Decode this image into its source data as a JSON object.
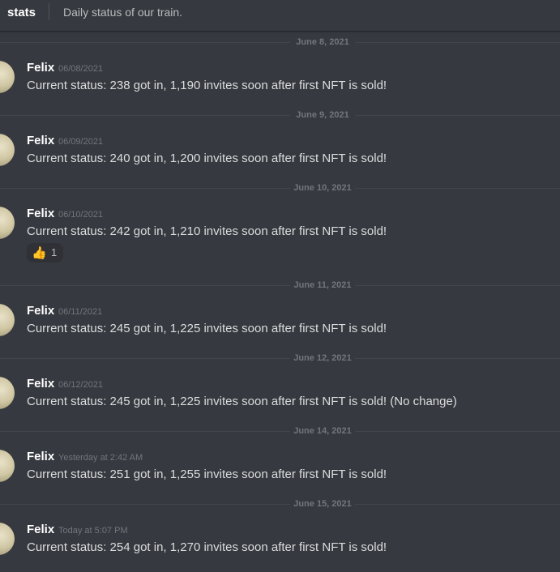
{
  "header": {
    "channel_name": "stats",
    "topic": "Daily status of our train."
  },
  "messages": [
    {
      "date": "June 8, 2021",
      "author": "Felix",
      "timestamp": "06/08/2021",
      "content": "Current status: 238 got in, 1,190 invites soon after first NFT is sold!"
    },
    {
      "date": "June 9, 2021",
      "author": "Felix",
      "timestamp": "06/09/2021",
      "content": "Current status: 240 got in, 1,200 invites soon after first NFT is sold!"
    },
    {
      "date": "June 10, 2021",
      "author": "Felix",
      "timestamp": "06/10/2021",
      "content": "Current status: 242 got in, 1,210 invites soon after first NFT is sold!",
      "reaction": {
        "emoji": "👍",
        "emoji_name": "thumbs-up-icon",
        "count": "1"
      }
    },
    {
      "date": "June 11, 2021",
      "author": "Felix",
      "timestamp": "06/11/2021",
      "content": "Current status: 245 got in, 1,225 invites soon after first NFT is sold!"
    },
    {
      "date": "June 12, 2021",
      "author": "Felix",
      "timestamp": "06/12/2021",
      "content": "Current status: 245 got in, 1,225 invites soon after first NFT is sold! (No change)"
    },
    {
      "date": "June 14, 2021",
      "author": "Felix",
      "timestamp": "Yesterday at 2:42 AM",
      "content": "Current status: 251 got in, 1,255 invites soon after first NFT is sold!"
    },
    {
      "date": "June 15, 2021",
      "author": "Felix",
      "timestamp": "Today at 5:07 PM",
      "content": "Current status: 254 got in, 1,270 invites soon after first NFT is sold!"
    }
  ],
  "colors": {
    "background": "#36393f",
    "username": "#ffffff",
    "message_text": "#dcddde",
    "muted": "#72767d"
  }
}
